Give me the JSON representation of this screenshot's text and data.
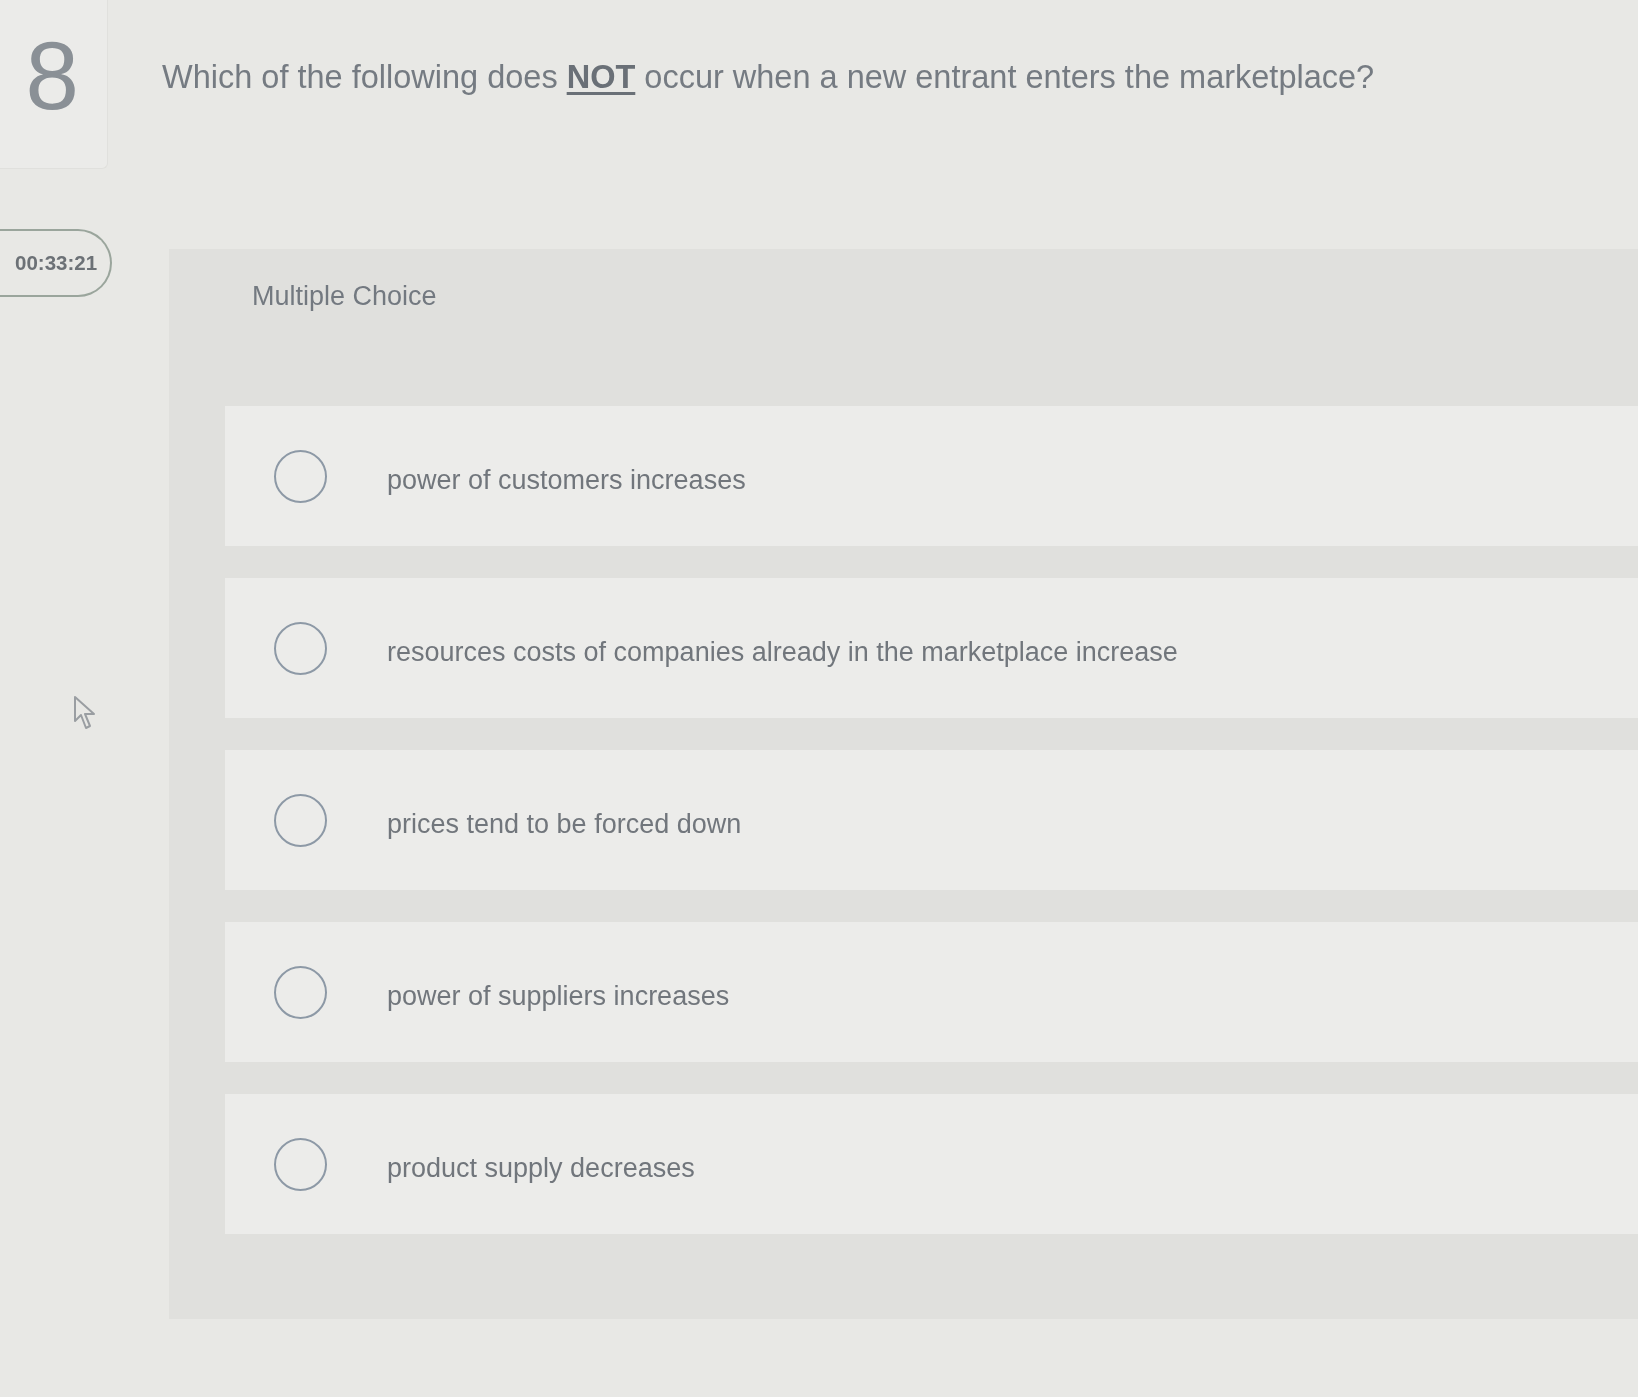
{
  "question_number": "8",
  "timer": "00:33:21",
  "question": "Which of the following does **NOT** occur when a new entrant enters the marketplace?",
  "question_type": "Multiple Choice",
  "options": [
    {
      "label": "power of customers increases",
      "selected": false
    },
    {
      "label": "resources costs of companies already in the marketplace increase",
      "selected": false
    },
    {
      "label": "prices tend to be forced down",
      "selected": false
    },
    {
      "label": "power of suppliers increases",
      "selected": false
    },
    {
      "label": "product supply decreases",
      "selected": false
    }
  ]
}
